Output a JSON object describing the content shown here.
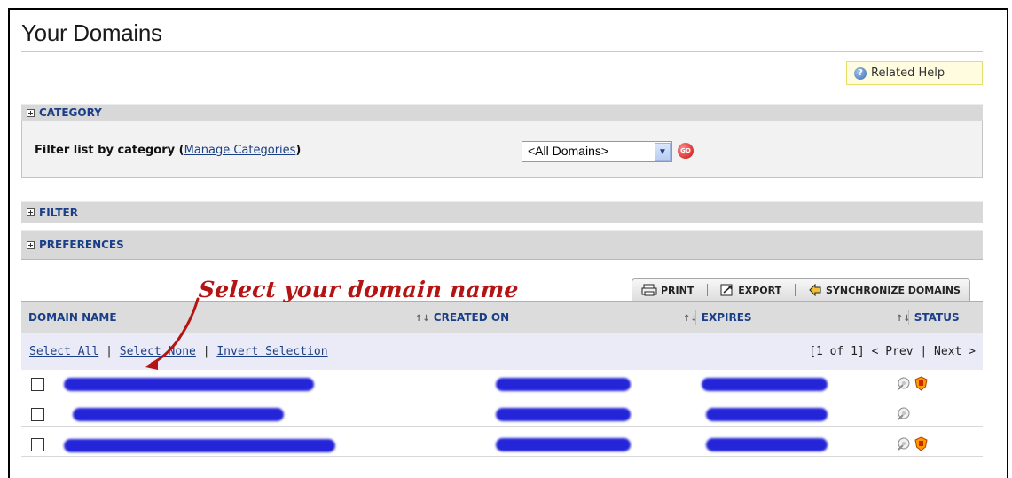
{
  "page": {
    "title": "Your Domains",
    "related_help": "Related Help"
  },
  "sections": {
    "category": "CATEGORY",
    "filter": "FILTER",
    "preferences": "PREFERENCES"
  },
  "category_panel": {
    "filter_label": "Filter list by category",
    "open_paren": "(",
    "manage_link": "Manage Categories",
    "close_paren": ")",
    "select_value": "<All Domains>",
    "go_label": "GO"
  },
  "toolbar": {
    "print": "PRINT",
    "export": "EXPORT",
    "synchronize": "SYNCHRONIZE DOMAINS"
  },
  "annotation": "Select your domain name",
  "table": {
    "columns": [
      "DOMAIN NAME",
      "CREATED ON",
      "EXPIRES",
      "STATUS"
    ],
    "sort_indicator": "↑↓"
  },
  "selection": {
    "select_all": "Select All",
    "select_none": "Select None",
    "invert": "Invert Selection",
    "separator": "|",
    "page_info": "[1 of 1]",
    "prev": "< Prev",
    "next": "Next >"
  },
  "rows": [
    {
      "status_icons": [
        "lock-icon",
        "shield-icon"
      ]
    },
    {
      "status_icons": [
        "lock-icon"
      ]
    },
    {
      "status_icons": [
        "lock-icon",
        "shield-icon"
      ]
    }
  ],
  "colors": {
    "link_blue": "#1b3f86",
    "band_gray": "#d8d8d8",
    "annotation_red": "#b51414",
    "redaction_blue": "#2424d8"
  }
}
